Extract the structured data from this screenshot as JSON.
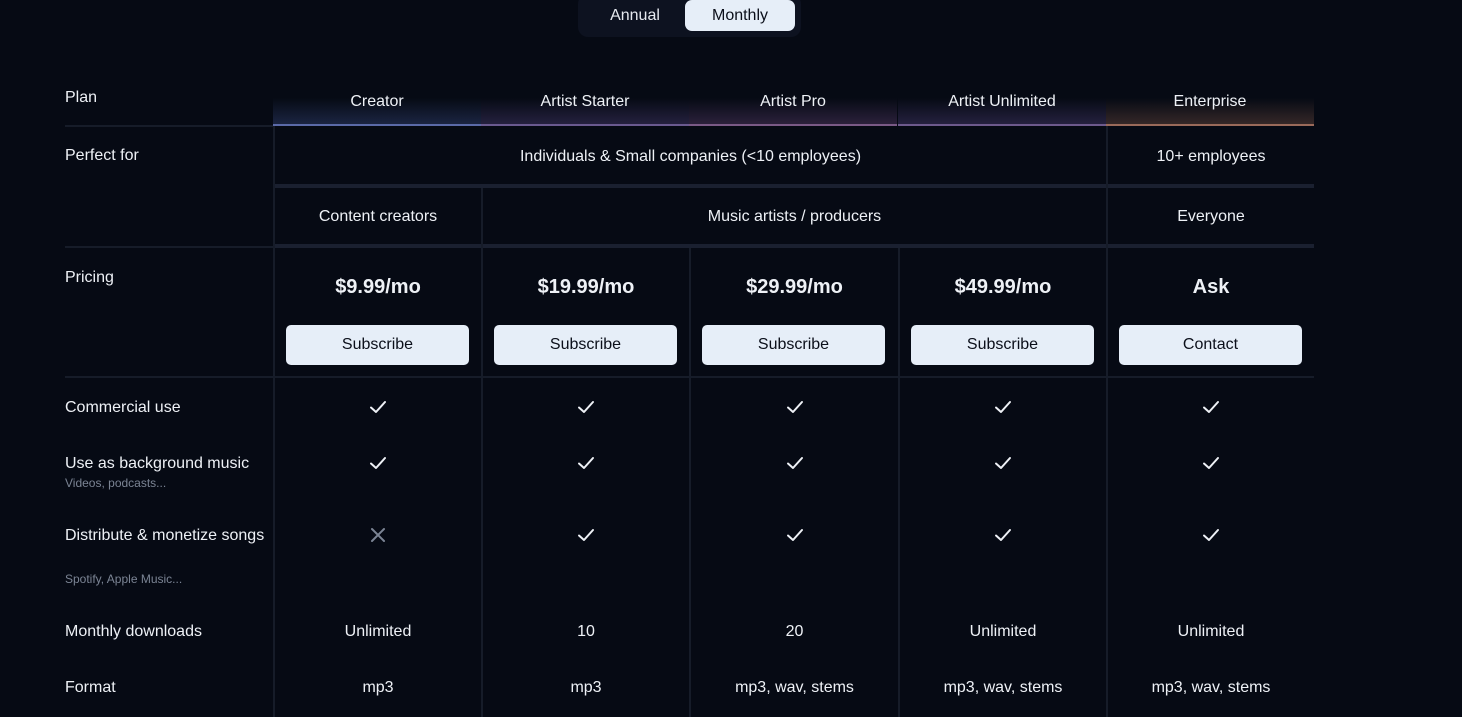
{
  "billing_toggle": {
    "annual_label": "Annual",
    "monthly_label": "Monthly",
    "selected": "Monthly"
  },
  "table": {
    "plan_label": "Plan",
    "plans": [
      {
        "name": "Creator",
        "price": "$9.99/mo",
        "cta": "Subscribe",
        "accent": "#5b6aa8"
      },
      {
        "name": "Artist Starter",
        "price": "$19.99/mo",
        "cta": "Subscribe",
        "accent": "#6a5a8f"
      },
      {
        "name": "Artist Pro",
        "price": "$29.99/mo",
        "cta": "Subscribe",
        "accent": "#7a5a86"
      },
      {
        "name": "Artist Unlimited",
        "price": "$49.99/mo",
        "cta": "Subscribe",
        "accent": "#6d5a8c"
      },
      {
        "name": "Enterprise",
        "price": "Ask",
        "cta": "Contact",
        "accent": "#9a6a5a"
      }
    ],
    "perfect_for": {
      "label": "Perfect for",
      "company_size": [
        "Individuals & Small companies (<10 employees)",
        "10+ employees"
      ],
      "audience": [
        "Content creators",
        "Music artists / producers",
        "Everyone"
      ]
    },
    "pricing_label": "Pricing",
    "features": [
      {
        "label": "Commercial use",
        "sublabel": "",
        "values": [
          "check",
          "check",
          "check",
          "check",
          "check"
        ]
      },
      {
        "label": "Use as background music",
        "sublabel": "Videos, podcasts...",
        "values": [
          "check",
          "check",
          "check",
          "check",
          "check"
        ]
      },
      {
        "label": "Distribute & monetize songs",
        "sublabel": "Spotify, Apple Music...",
        "values": [
          "cross",
          "check",
          "check",
          "check",
          "check"
        ]
      }
    ],
    "monthly_downloads": {
      "label": "Monthly downloads",
      "values": [
        "Unlimited",
        "10",
        "20",
        "Unlimited",
        "Unlimited"
      ]
    },
    "format": {
      "label": "Format",
      "values": [
        "mp3",
        "mp3",
        "mp3, wav, stems",
        "mp3, wav, stems",
        "mp3, wav, stems"
      ]
    }
  }
}
